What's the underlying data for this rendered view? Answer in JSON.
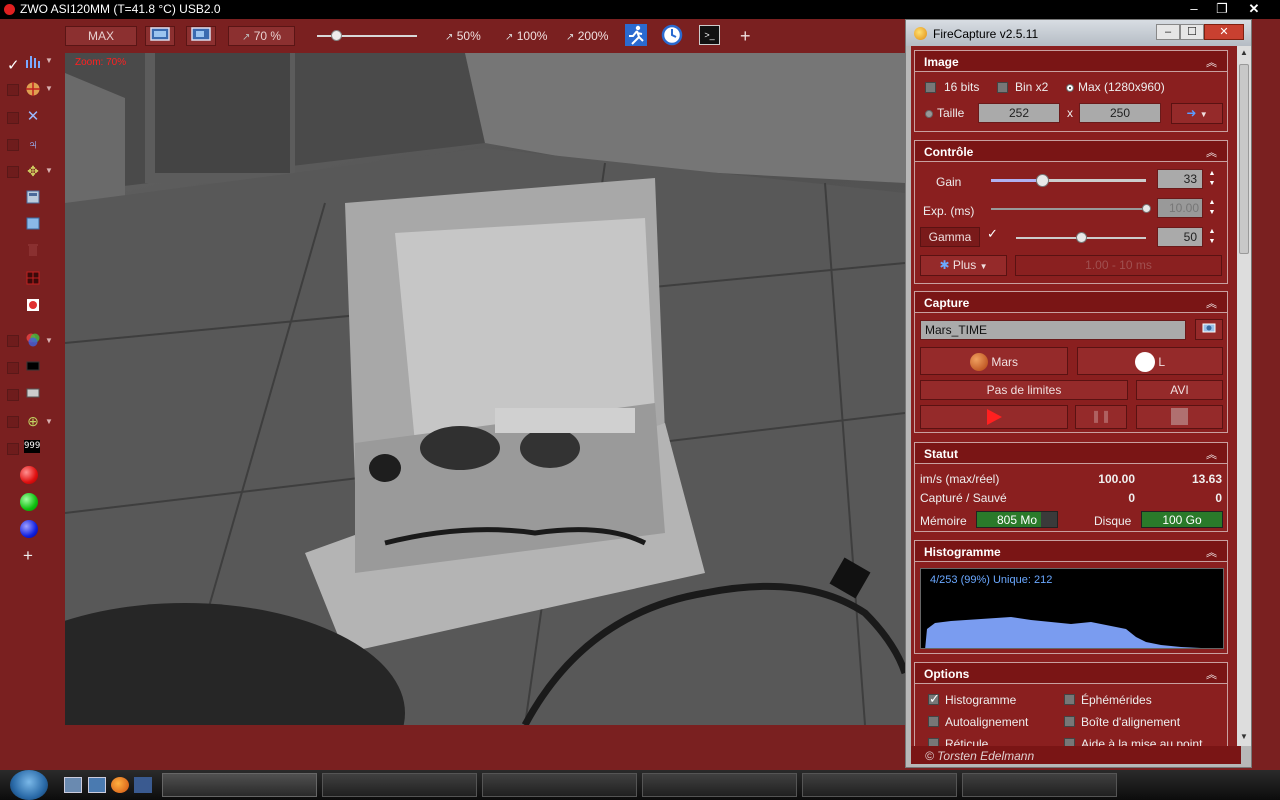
{
  "window": {
    "title": "ZWO ASI120MM (T=41.8 °C) USB2.0",
    "controls": [
      "–",
      "❐",
      "✕"
    ]
  },
  "toolbar": {
    "max_label": "MAX",
    "zoom_display": "70 %",
    "zoom_50": "50%",
    "zoom_100": "100%",
    "zoom_200": "200%",
    "add_label": "+"
  },
  "sidebar": {
    "add_label": "+",
    "digits_label": "999"
  },
  "video": {
    "zoom_overlay": "Zoom: 70%"
  },
  "panel": {
    "title": "FireCapture v2.5.11",
    "controls": [
      "–",
      "☐",
      "✕"
    ],
    "image": {
      "header": "Image",
      "bits16": "16 bits",
      "bin2": "Bin x2",
      "max_res": "Max (1280x960)",
      "taille": "Taille",
      "width": "252",
      "sep": "x",
      "height": "250"
    },
    "controle": {
      "header": "Contrôle",
      "gain_label": "Gain",
      "gain_value": "33",
      "gain_level": 0.33,
      "exp_label": "Exp. (ms)",
      "exp_value": "10.00",
      "exp_level": 1.0,
      "gamma_label": "Gamma",
      "gamma_value": "50",
      "gamma_level": 0.5,
      "plus_label": "Plus",
      "range_label": "1.00 - 10 ms"
    },
    "capture": {
      "header": "Capture",
      "name_value": "Mars_TIME",
      "planet_label": "Mars",
      "filter_label": "L",
      "limit_label": "Pas de limites",
      "format_label": "AVI"
    },
    "statut": {
      "header": "Statut",
      "fps_label": "im/s (max/réel)",
      "fps_max": "100.00",
      "fps_real": "13.63",
      "captured_label": "Capturé / Sauvé",
      "captured": "0",
      "saved": "0",
      "memory_label": "Mémoire",
      "memory_value": "805 Mo",
      "disk_label": "Disque",
      "disk_value": "100 Go"
    },
    "histogramme": {
      "header": "Histogramme",
      "stats": "4/253 (99%)  Unique: 212"
    },
    "options": {
      "header": "Options",
      "items": [
        {
          "label": "Histogramme",
          "checked": true
        },
        {
          "label": "Éphémérides",
          "checked": false
        },
        {
          "label": "Autoalignement",
          "checked": false
        },
        {
          "label": "Boîte d'alignement",
          "checked": false
        },
        {
          "label": "Réticule",
          "checked": false
        },
        {
          "label": "Aide à la mise au point",
          "checked": false
        }
      ]
    },
    "footer": "© Torsten Edelmann"
  },
  "colors": {
    "background": "#7a2020",
    "panel_section": "#8a1f1f",
    "histogram": "#7a9cf0",
    "memory_bar": "#2a7a2a"
  }
}
